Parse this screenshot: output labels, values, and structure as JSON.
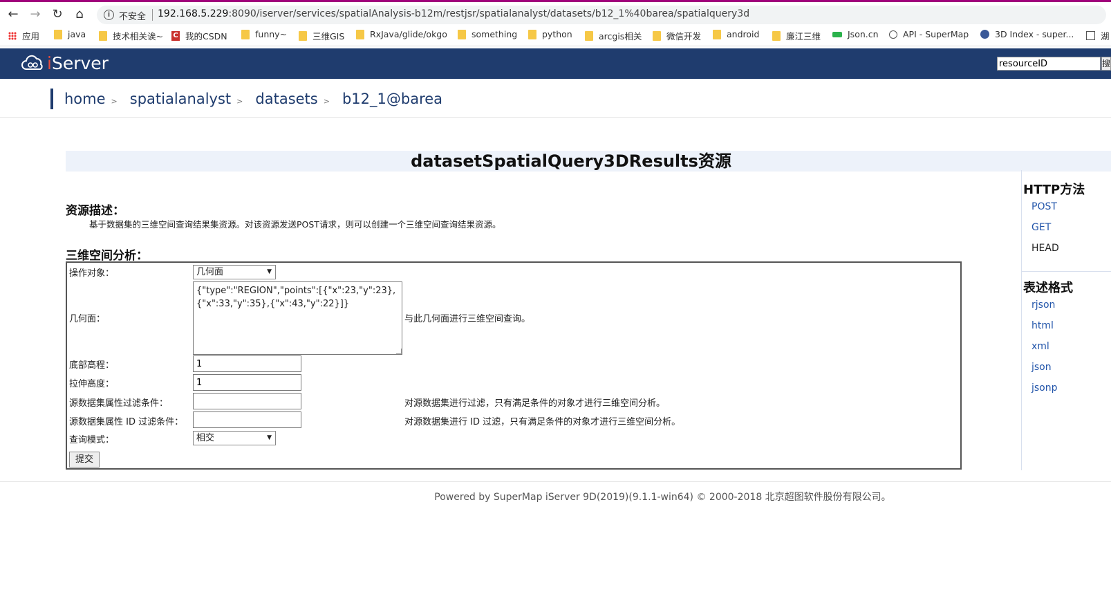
{
  "browser": {
    "insecure_label": "不安全",
    "url_host": "192.168.5.229",
    "url_rest": ":8090/iserver/services/spatialAnalysis-b12m/restjsr/spatialanalyst/datasets/b12_1%40barea/spatialquery3d"
  },
  "bookmarks": [
    {
      "label": "应用",
      "icon": "apps-icon"
    },
    {
      "label": "java",
      "icon": "folder-icon"
    },
    {
      "label": "技术相关诶~",
      "icon": "folder-icon"
    },
    {
      "label": "我的CSDN",
      "icon": "csdn-icon"
    },
    {
      "label": "funny~",
      "icon": "folder-icon"
    },
    {
      "label": "三维GIS",
      "icon": "folder-icon"
    },
    {
      "label": "RxJava/glide/okgo",
      "icon": "folder-icon"
    },
    {
      "label": "something",
      "icon": "folder-icon"
    },
    {
      "label": "python",
      "icon": "folder-icon"
    },
    {
      "label": "arcgis相关",
      "icon": "folder-icon"
    },
    {
      "label": "微信开发",
      "icon": "folder-icon"
    },
    {
      "label": "android",
      "icon": "folder-icon"
    },
    {
      "label": "廉江三维",
      "icon": "folder-icon"
    },
    {
      "label": "Json.cn",
      "icon": "jsoncn-icon"
    },
    {
      "label": "API - SuperMap",
      "icon": "globe-icon"
    },
    {
      "label": "3D Index - super...",
      "icon": "index-icon"
    },
    {
      "label": "湖",
      "icon": "image-icon"
    }
  ],
  "header": {
    "logo_i": "i",
    "logo_rest": "Server",
    "search_value": "resourceID",
    "search_button": "搜"
  },
  "breadcrumb": [
    "home",
    "spatialanalyst",
    "datasets",
    "b12_1@barea"
  ],
  "crumb_sep": ">",
  "page_title": "datasetSpatialQuery3DResults资源",
  "description": {
    "heading": "资源描述：",
    "text": "基于数据集的三维空间查询结果集资源。对该资源发送POST请求，则可以创建一个三维空间查询结果资源。"
  },
  "form": {
    "heading": "三维空间分析：",
    "operation_label": "操作对象：",
    "operation_value": "几何面",
    "geometry_label": "几何面：",
    "geometry_value": "{\"type\":\"REGION\",\"points\":[{\"x\":23,\"y\":23},{\"x\":33,\"y\":35},{\"x\":43,\"y\":22}]}",
    "geometry_note": "与此几何面进行三维空间查询。",
    "bottom_label": "底部高程：",
    "bottom_value": "1",
    "extrude_label": "拉伸高度：",
    "extrude_value": "1",
    "attr_filter_label": "源数据集属性过滤条件：",
    "attr_filter_value": "",
    "attr_filter_note": "对源数据集进行过滤，只有满足条件的对象才进行三维空间分析。",
    "id_filter_label": "源数据集属性 ID 过滤条件：",
    "id_filter_value": "",
    "id_filter_note": "对源数据集进行 ID 过滤，只有满足条件的对象才进行三维空间分析。",
    "mode_label": "查询模式：",
    "mode_value": "相交",
    "submit": "提交"
  },
  "right_panel": {
    "http_heading": "HTTP方法",
    "http_methods": [
      "POST",
      "GET",
      "HEAD"
    ],
    "format_heading": "表述格式",
    "formats": [
      "rjson",
      "html",
      "xml",
      "json",
      "jsonp"
    ]
  },
  "footer": "Powered by SuperMap iServer 9D(2019)(9.1.1-win64) © 2000-2018 北京超图软件股份有限公司。",
  "colors": {
    "header_bg": "#1f3c6e",
    "link": "#2255aa",
    "title_band": "#edf2fa"
  }
}
